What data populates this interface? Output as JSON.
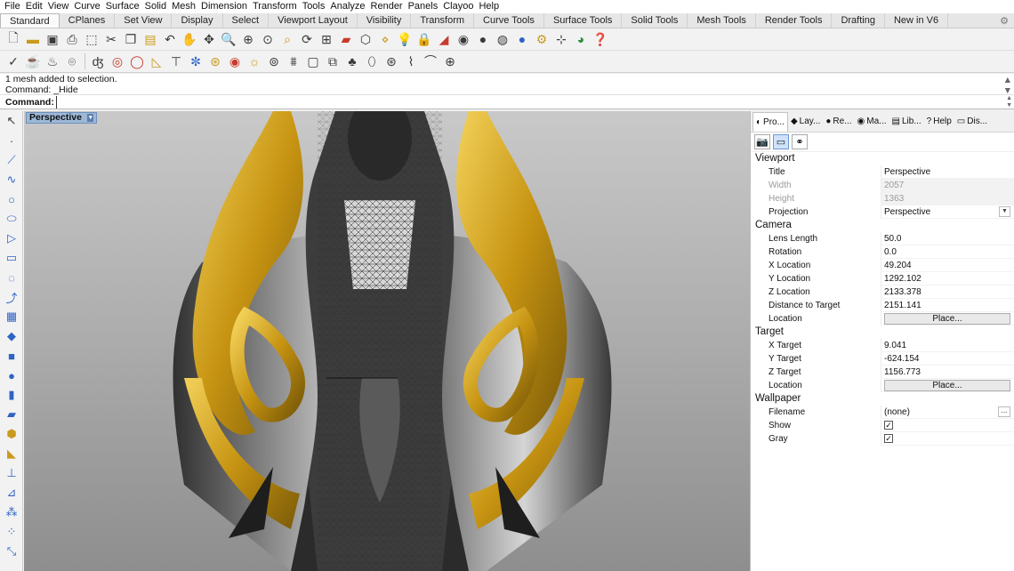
{
  "menu": [
    "File",
    "Edit",
    "View",
    "Curve",
    "Surface",
    "Solid",
    "Mesh",
    "Dimension",
    "Transform",
    "Tools",
    "Analyze",
    "Render",
    "Panels",
    "Clayoo",
    "Help"
  ],
  "tabs": [
    "Standard",
    "CPlanes",
    "Set View",
    "Display",
    "Select",
    "Viewport Layout",
    "Visibility",
    "Transform",
    "Curve Tools",
    "Surface Tools",
    "Solid Tools",
    "Mesh Tools",
    "Render Tools",
    "Drafting",
    "New in V6"
  ],
  "command": {
    "history": [
      "1 mesh added to selection.",
      "Command: _Hide"
    ],
    "prompt_label": "Command:",
    "value": ""
  },
  "viewport": {
    "title": "Perspective",
    "dropdown_glyph": "▾"
  },
  "panel": {
    "tabs": [
      {
        "icon": "◐",
        "label": "Pro..."
      },
      {
        "icon": "◆",
        "label": "Lay..."
      },
      {
        "icon": "●",
        "label": "Re..."
      },
      {
        "icon": "◉",
        "label": "Ma..."
      },
      {
        "icon": "▤",
        "label": "Lib..."
      },
      {
        "icon": "?",
        "label": "Help"
      },
      {
        "icon": "▭",
        "label": "Dis..."
      }
    ],
    "viewport_header": "Viewport",
    "title_label": "Title",
    "title_value": "Perspective",
    "width_label": "Width",
    "width_value": "2057",
    "height_label": "Height",
    "height_value": "1363",
    "projection_label": "Projection",
    "projection_value": "Perspective",
    "camera_header": "Camera",
    "lens_label": "Lens Length",
    "lens_value": "50.0",
    "rotation_label": "Rotation",
    "rotation_value": "0.0",
    "cx_label": "X Location",
    "cx_value": "49.204",
    "cy_label": "Y Location",
    "cy_value": "1292.102",
    "cz_label": "Z Location",
    "cz_value": "2133.378",
    "dist_label": "Distance to Target",
    "dist_value": "2151.141",
    "loc_label": "Location",
    "place_label": "Place...",
    "target_header": "Target",
    "tx_label": "X Target",
    "tx_value": "9.041",
    "ty_label": "Y Target",
    "ty_value": "-624.154",
    "tz_label": "Z Target",
    "tz_value": "1156.773",
    "tloc_label": "Location",
    "wallpaper_header": "Wallpaper",
    "filename_label": "Filename",
    "filename_value": "(none)",
    "show_label": "Show",
    "gray_label": "Gray",
    "browse_label": "...",
    "check_glyph": "✓"
  },
  "colors": {
    "gold": "#e0b428",
    "chrome": "#8a8a8a",
    "viewport_top": "#c9c9c9",
    "viewport_bottom": "#8e8e8e",
    "viewport_title": "#9db8d8"
  }
}
